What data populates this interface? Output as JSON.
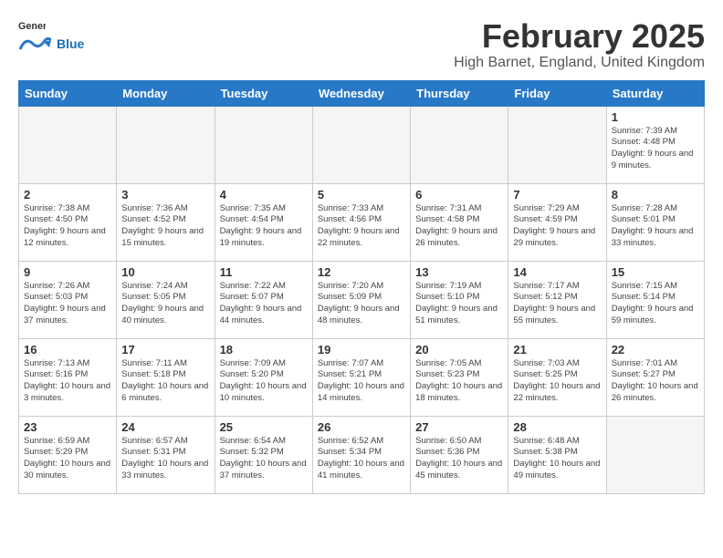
{
  "logo": {
    "general": "General",
    "blue": "Blue"
  },
  "title": {
    "month": "February 2025",
    "location": "High Barnet, England, United Kingdom"
  },
  "headers": [
    "Sunday",
    "Monday",
    "Tuesday",
    "Wednesday",
    "Thursday",
    "Friday",
    "Saturday"
  ],
  "weeks": [
    [
      {
        "day": "",
        "info": ""
      },
      {
        "day": "",
        "info": ""
      },
      {
        "day": "",
        "info": ""
      },
      {
        "day": "",
        "info": ""
      },
      {
        "day": "",
        "info": ""
      },
      {
        "day": "",
        "info": ""
      },
      {
        "day": "1",
        "info": "Sunrise: 7:39 AM\nSunset: 4:48 PM\nDaylight: 9 hours and 9 minutes."
      }
    ],
    [
      {
        "day": "2",
        "info": "Sunrise: 7:38 AM\nSunset: 4:50 PM\nDaylight: 9 hours and 12 minutes."
      },
      {
        "day": "3",
        "info": "Sunrise: 7:36 AM\nSunset: 4:52 PM\nDaylight: 9 hours and 15 minutes."
      },
      {
        "day": "4",
        "info": "Sunrise: 7:35 AM\nSunset: 4:54 PM\nDaylight: 9 hours and 19 minutes."
      },
      {
        "day": "5",
        "info": "Sunrise: 7:33 AM\nSunset: 4:56 PM\nDaylight: 9 hours and 22 minutes."
      },
      {
        "day": "6",
        "info": "Sunrise: 7:31 AM\nSunset: 4:58 PM\nDaylight: 9 hours and 26 minutes."
      },
      {
        "day": "7",
        "info": "Sunrise: 7:29 AM\nSunset: 4:59 PM\nDaylight: 9 hours and 29 minutes."
      },
      {
        "day": "8",
        "info": "Sunrise: 7:28 AM\nSunset: 5:01 PM\nDaylight: 9 hours and 33 minutes."
      }
    ],
    [
      {
        "day": "9",
        "info": "Sunrise: 7:26 AM\nSunset: 5:03 PM\nDaylight: 9 hours and 37 minutes."
      },
      {
        "day": "10",
        "info": "Sunrise: 7:24 AM\nSunset: 5:05 PM\nDaylight: 9 hours and 40 minutes."
      },
      {
        "day": "11",
        "info": "Sunrise: 7:22 AM\nSunset: 5:07 PM\nDaylight: 9 hours and 44 minutes."
      },
      {
        "day": "12",
        "info": "Sunrise: 7:20 AM\nSunset: 5:09 PM\nDaylight: 9 hours and 48 minutes."
      },
      {
        "day": "13",
        "info": "Sunrise: 7:19 AM\nSunset: 5:10 PM\nDaylight: 9 hours and 51 minutes."
      },
      {
        "day": "14",
        "info": "Sunrise: 7:17 AM\nSunset: 5:12 PM\nDaylight: 9 hours and 55 minutes."
      },
      {
        "day": "15",
        "info": "Sunrise: 7:15 AM\nSunset: 5:14 PM\nDaylight: 9 hours and 59 minutes."
      }
    ],
    [
      {
        "day": "16",
        "info": "Sunrise: 7:13 AM\nSunset: 5:16 PM\nDaylight: 10 hours and 3 minutes."
      },
      {
        "day": "17",
        "info": "Sunrise: 7:11 AM\nSunset: 5:18 PM\nDaylight: 10 hours and 6 minutes."
      },
      {
        "day": "18",
        "info": "Sunrise: 7:09 AM\nSunset: 5:20 PM\nDaylight: 10 hours and 10 minutes."
      },
      {
        "day": "19",
        "info": "Sunrise: 7:07 AM\nSunset: 5:21 PM\nDaylight: 10 hours and 14 minutes."
      },
      {
        "day": "20",
        "info": "Sunrise: 7:05 AM\nSunset: 5:23 PM\nDaylight: 10 hours and 18 minutes."
      },
      {
        "day": "21",
        "info": "Sunrise: 7:03 AM\nSunset: 5:25 PM\nDaylight: 10 hours and 22 minutes."
      },
      {
        "day": "22",
        "info": "Sunrise: 7:01 AM\nSunset: 5:27 PM\nDaylight: 10 hours and 26 minutes."
      }
    ],
    [
      {
        "day": "23",
        "info": "Sunrise: 6:59 AM\nSunset: 5:29 PM\nDaylight: 10 hours and 30 minutes."
      },
      {
        "day": "24",
        "info": "Sunrise: 6:57 AM\nSunset: 5:31 PM\nDaylight: 10 hours and 33 minutes."
      },
      {
        "day": "25",
        "info": "Sunrise: 6:54 AM\nSunset: 5:32 PM\nDaylight: 10 hours and 37 minutes."
      },
      {
        "day": "26",
        "info": "Sunrise: 6:52 AM\nSunset: 5:34 PM\nDaylight: 10 hours and 41 minutes."
      },
      {
        "day": "27",
        "info": "Sunrise: 6:50 AM\nSunset: 5:36 PM\nDaylight: 10 hours and 45 minutes."
      },
      {
        "day": "28",
        "info": "Sunrise: 6:48 AM\nSunset: 5:38 PM\nDaylight: 10 hours and 49 minutes."
      },
      {
        "day": "",
        "info": ""
      }
    ]
  ]
}
